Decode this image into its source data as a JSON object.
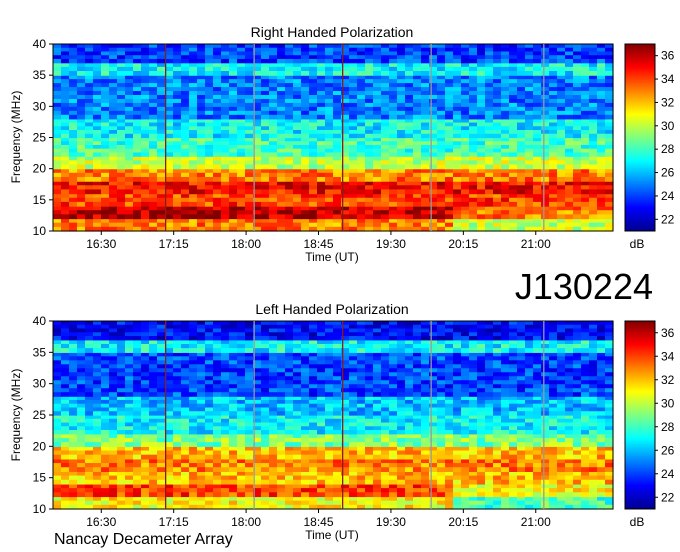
{
  "figure": {
    "observation_id": "J130224",
    "instrument": "Nancay Decameter Array"
  },
  "chart_data": [
    {
      "type": "heatmap",
      "title": "Right Handed Polarization",
      "xlabel": "Time (UT)",
      "ylabel": "Frequency (MHz)",
      "x_ticks": [
        "16:30",
        "17:15",
        "18:00",
        "18:45",
        "19:30",
        "20:15",
        "21:00"
      ],
      "y_ticks": [
        10,
        15,
        20,
        25,
        30,
        35,
        40
      ],
      "x_range": [
        "16:00",
        "21:48"
      ],
      "ylim": [
        10,
        40
      ],
      "colorbar": {
        "label": "dB",
        "ticks": [
          22,
          24,
          26,
          28,
          30,
          32,
          34,
          36
        ],
        "range": [
          21,
          37
        ],
        "colormap": "jet"
      },
      "vertical_markers": [
        "17:10",
        "18:05",
        "19:00",
        "19:55",
        "21:05"
      ],
      "bands": [
        {
          "f_min": 10,
          "f_max": 12,
          "level_db": 33
        },
        {
          "f_min": 12,
          "f_max": 14,
          "level_db": 36
        },
        {
          "f_min": 14,
          "f_max": 16,
          "level_db": 34
        },
        {
          "f_min": 16,
          "f_max": 18,
          "level_db": 35
        },
        {
          "f_min": 18,
          "f_max": 20,
          "level_db": 33
        },
        {
          "f_min": 20,
          "f_max": 22,
          "level_db": 30
        },
        {
          "f_min": 22,
          "f_max": 25,
          "level_db": 28
        },
        {
          "f_min": 25,
          "f_max": 28,
          "level_db": 27
        },
        {
          "f_min": 28,
          "f_max": 35,
          "level_db": 25
        },
        {
          "f_min": 35,
          "f_max": 37,
          "level_db": 27
        },
        {
          "f_min": 37,
          "f_max": 40,
          "level_db": 24
        }
      ]
    },
    {
      "type": "heatmap",
      "title": "Left Handed Polarization",
      "xlabel": "Time (UT)",
      "ylabel": "Frequency (MHz)",
      "x_ticks": [
        "16:30",
        "17:15",
        "18:00",
        "18:45",
        "19:30",
        "20:15",
        "21:00"
      ],
      "y_ticks": [
        10,
        15,
        20,
        25,
        30,
        35,
        40
      ],
      "x_range": [
        "16:00",
        "21:48"
      ],
      "ylim": [
        10,
        40
      ],
      "colorbar": {
        "label": "dB",
        "ticks": [
          22,
          24,
          26,
          28,
          30,
          32,
          34,
          36
        ],
        "range": [
          21,
          37
        ],
        "colormap": "jet"
      },
      "vertical_markers": [
        "17:10",
        "18:05",
        "19:00",
        "19:55",
        "21:05"
      ],
      "bands": [
        {
          "f_min": 10,
          "f_max": 12,
          "level_db": 31
        },
        {
          "f_min": 12,
          "f_max": 14,
          "level_db": 34
        },
        {
          "f_min": 14,
          "f_max": 16,
          "level_db": 32
        },
        {
          "f_min": 16,
          "f_max": 18,
          "level_db": 33
        },
        {
          "f_min": 18,
          "f_max": 20,
          "level_db": 32
        },
        {
          "f_min": 20,
          "f_max": 22,
          "level_db": 29
        },
        {
          "f_min": 22,
          "f_max": 25,
          "level_db": 27
        },
        {
          "f_min": 25,
          "f_max": 28,
          "level_db": 26
        },
        {
          "f_min": 28,
          "f_max": 35,
          "level_db": 24
        },
        {
          "f_min": 35,
          "f_max": 37,
          "level_db": 27
        },
        {
          "f_min": 37,
          "f_max": 40,
          "level_db": 23
        }
      ]
    }
  ]
}
